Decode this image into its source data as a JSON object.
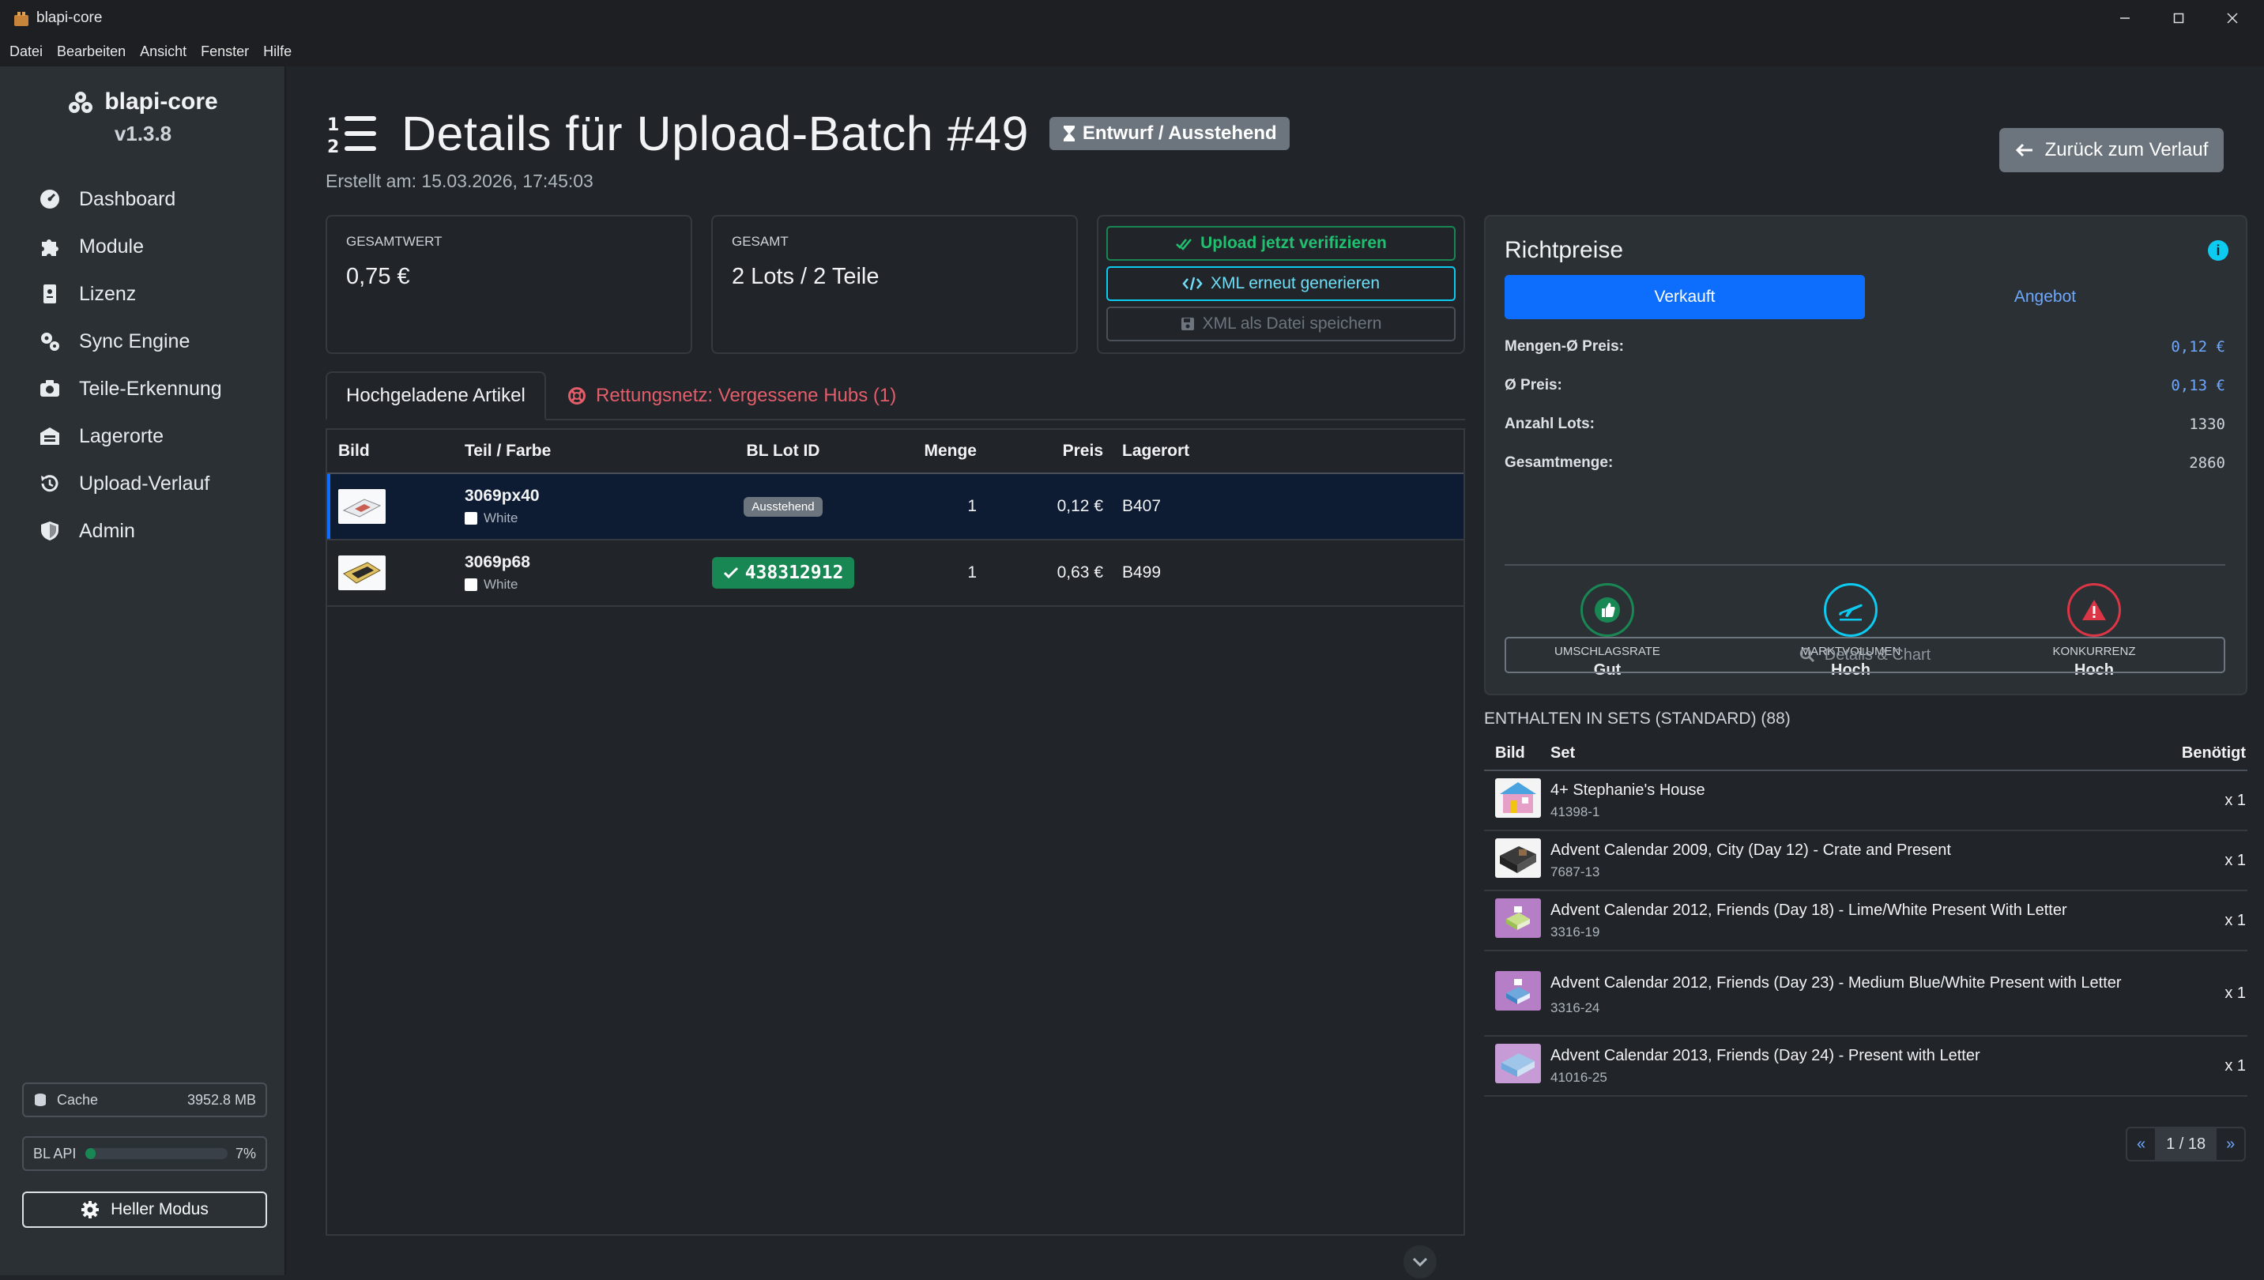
{
  "window": {
    "title": "blapi-core"
  },
  "menu": [
    "Datei",
    "Bearbeiten",
    "Ansicht",
    "Fenster",
    "Hilfe"
  ],
  "sidebar": {
    "app_name": "blapi-core",
    "version": "v1.3.8",
    "items": [
      {
        "label": "Dashboard",
        "icon": "gauge-icon"
      },
      {
        "label": "Module",
        "icon": "puzzle-icon"
      },
      {
        "label": "Lizenz",
        "icon": "license-icon"
      },
      {
        "label": "Sync Engine",
        "icon": "gears-icon"
      },
      {
        "label": "Teile-Erkennung",
        "icon": "camera-icon"
      },
      {
        "label": "Lagerorte",
        "icon": "warehouse-icon"
      },
      {
        "label": "Upload-Verlauf",
        "icon": "history-icon"
      },
      {
        "label": "Admin",
        "icon": "shield-icon"
      }
    ],
    "cache_label": "Cache",
    "cache_value": "3952.8 MB",
    "api_label": "BL API",
    "api_pct_text": "7%",
    "api_fraction": 0.07,
    "theme_button": "Heller Modus"
  },
  "page": {
    "title": "Details für Upload-Batch #49",
    "status": "Entwurf / Ausstehend",
    "created": "Erstellt am: 15.03.2026, 17:45:03",
    "back_button": "Zurück zum Verlauf"
  },
  "stats": {
    "total_value_label": "GESAMTWERT",
    "total_value": "0,75 €",
    "total_label": "GESAMT",
    "total": "2 Lots / 2 Teile"
  },
  "actions": {
    "verify": "Upload jetzt verifizieren",
    "regenerate": "XML erneut generieren",
    "save": "XML als Datei speichern"
  },
  "tabs": {
    "uploaded": "Hochgeladene Artikel",
    "rescue": "Rettungsnetz: Vergessene Hubs (1)"
  },
  "table": {
    "headers": {
      "image": "Bild",
      "part": "Teil / Farbe",
      "lot": "BL Lot ID",
      "qty": "Menge",
      "price": "Preis",
      "location": "Lagerort"
    },
    "rows": [
      {
        "part": "3069px40",
        "color": "White",
        "lot": "Ausstehend",
        "qty": "1",
        "price": "0,12 €",
        "location": "B407"
      },
      {
        "part": "3069p68",
        "color": "White",
        "lot": "438312912",
        "qty": "1",
        "price": "0,63 €",
        "location": "B499"
      }
    ]
  },
  "guide": {
    "title": "Richtpreise",
    "tab_sold": "Verkauft",
    "tab_offer": "Angebot",
    "rows": [
      {
        "k": "Mengen-Ø Preis:",
        "v": "0,12 €"
      },
      {
        "k": "Ø Preis:",
        "v": "0,13 €"
      },
      {
        "k": "Anzahl Lots:",
        "v": "1330"
      },
      {
        "k": "Gesamtmenge:",
        "v": "2860"
      }
    ],
    "indicators": [
      {
        "label": "UMSCHLAGSRATE",
        "value": "Gut",
        "color": "#198754"
      },
      {
        "label": "MARKTVOLUMEN",
        "value": "Hoch",
        "color": "#0dcaf0"
      },
      {
        "label": "KONKURRENZ",
        "value": "Hoch",
        "color": "#dc3545"
      }
    ],
    "details_button": "Details & Chart"
  },
  "sets": {
    "heading": "ENTHALTEN IN SETS (STANDARD) (88)",
    "headers": {
      "image": "Bild",
      "set": "Set",
      "needed": "Benötigt"
    },
    "rows": [
      {
        "name": "4+ Stephanie's House",
        "id": "41398-1",
        "needed": "x 1"
      },
      {
        "name": "Advent Calendar 2009, City (Day 12) - Crate and Present",
        "id": "7687-13",
        "needed": "x 1"
      },
      {
        "name": "Advent Calendar 2012, Friends (Day 18) - Lime/White Present With Letter",
        "id": "3316-19",
        "needed": "x 1"
      },
      {
        "name": "Advent Calendar 2012, Friends (Day 23) - Medium Blue/White Present with Letter",
        "id": "3316-24",
        "needed": "x 1"
      },
      {
        "name": "Advent Calendar 2013, Friends (Day 24) - Present with Letter",
        "id": "41016-25",
        "needed": "x 1"
      }
    ],
    "pager": {
      "prev": "«",
      "page": "1 / 18",
      "next": "»"
    }
  }
}
